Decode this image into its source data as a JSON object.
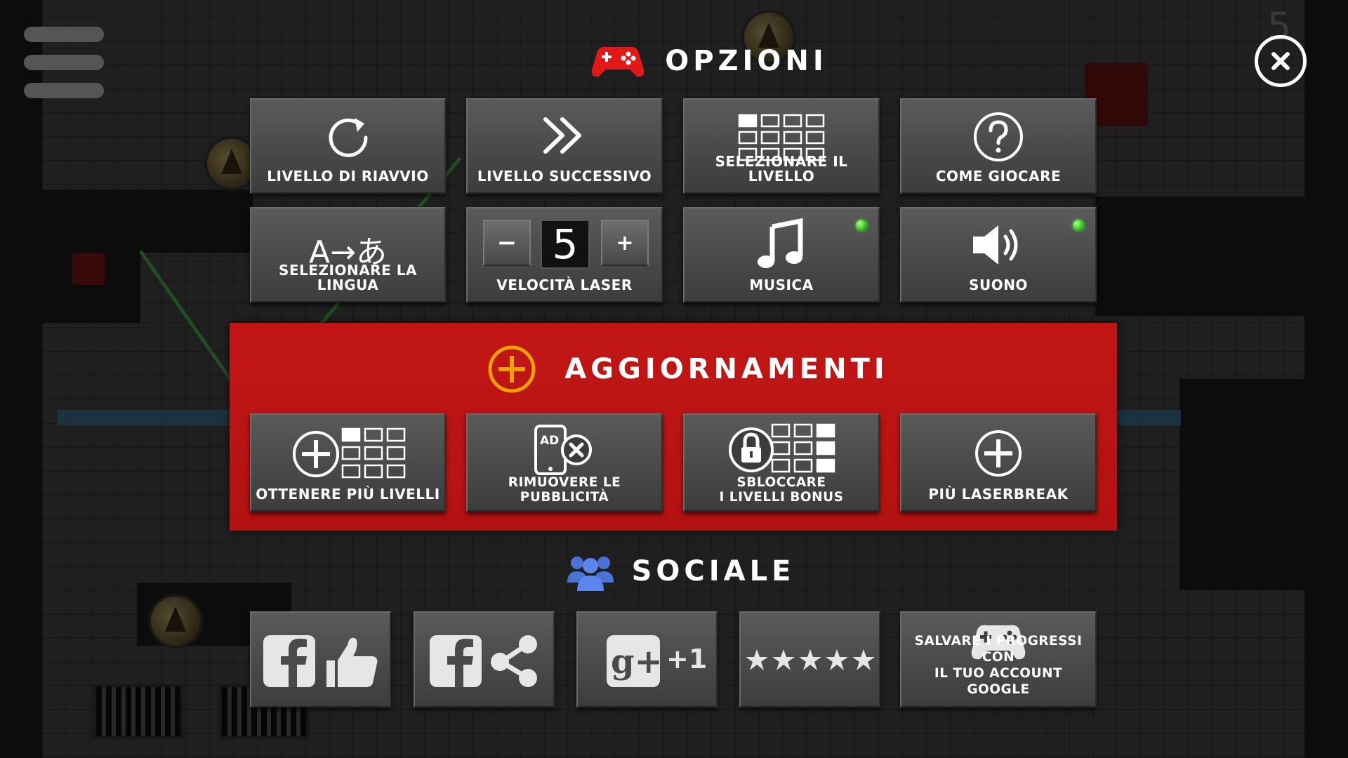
{
  "hud": {
    "level_number": "5"
  },
  "options": {
    "title": "OPZIONI",
    "buttons": {
      "restart": "LIVELLO DI RIAVVIO",
      "next": "LIVELLO SUCCESSIVO",
      "select_level": "SELEZIONARE IL LIVELLO",
      "how_to_play": "COME GIOCARE",
      "language": "SELEZIONARE LA LINGUA",
      "language_icon_text": "A→あ",
      "laser_speed": "VELOCITÀ LASER",
      "laser_speed_value": "5",
      "laser_minus": "−",
      "laser_plus": "+",
      "music": "MUSICA",
      "sound": "SUONO"
    },
    "music_enabled": true,
    "sound_enabled": true
  },
  "upgrades": {
    "title": "AGGIORNAMENTI",
    "buttons": {
      "more_levels": "OTTENERE PIÙ LIVELLI",
      "remove_ads_line1": "RIMUOVERE LE",
      "remove_ads_line2": "PUBBLICITÀ",
      "ad_text": "AD",
      "bonus_line1": "SBLOCCARE",
      "bonus_line2": "I LIVELLI BONUS",
      "more_laserbreak": "PIÙ LASERBREAK"
    }
  },
  "social": {
    "title": "SOCIALE",
    "buttons": {
      "gplus_text": "+1",
      "save_line1": "SALVARE I PROGRESSI CON",
      "save_line2": "IL TUO ACCOUNT GOOGLE"
    }
  },
  "colors": {
    "upgrades_panel": "#c21616",
    "led_on": "#2fc21c",
    "plus_circle": "#f0a000",
    "gamepad": "#e01818",
    "social_icon": "#4a73d8"
  },
  "icons": [
    "hamburger-menu-icon",
    "close-icon",
    "gamepad-icon",
    "restart-icon",
    "fast-forward-icon",
    "level-grid-icon",
    "question-icon",
    "music-note-icon",
    "speaker-icon",
    "plus-circle-icon",
    "lock-icon",
    "ad-phone-icon",
    "people-icon",
    "facebook-icon",
    "thumbs-up-icon",
    "share-icon",
    "google-plus-icon",
    "stars-icon",
    "controller-icon"
  ]
}
